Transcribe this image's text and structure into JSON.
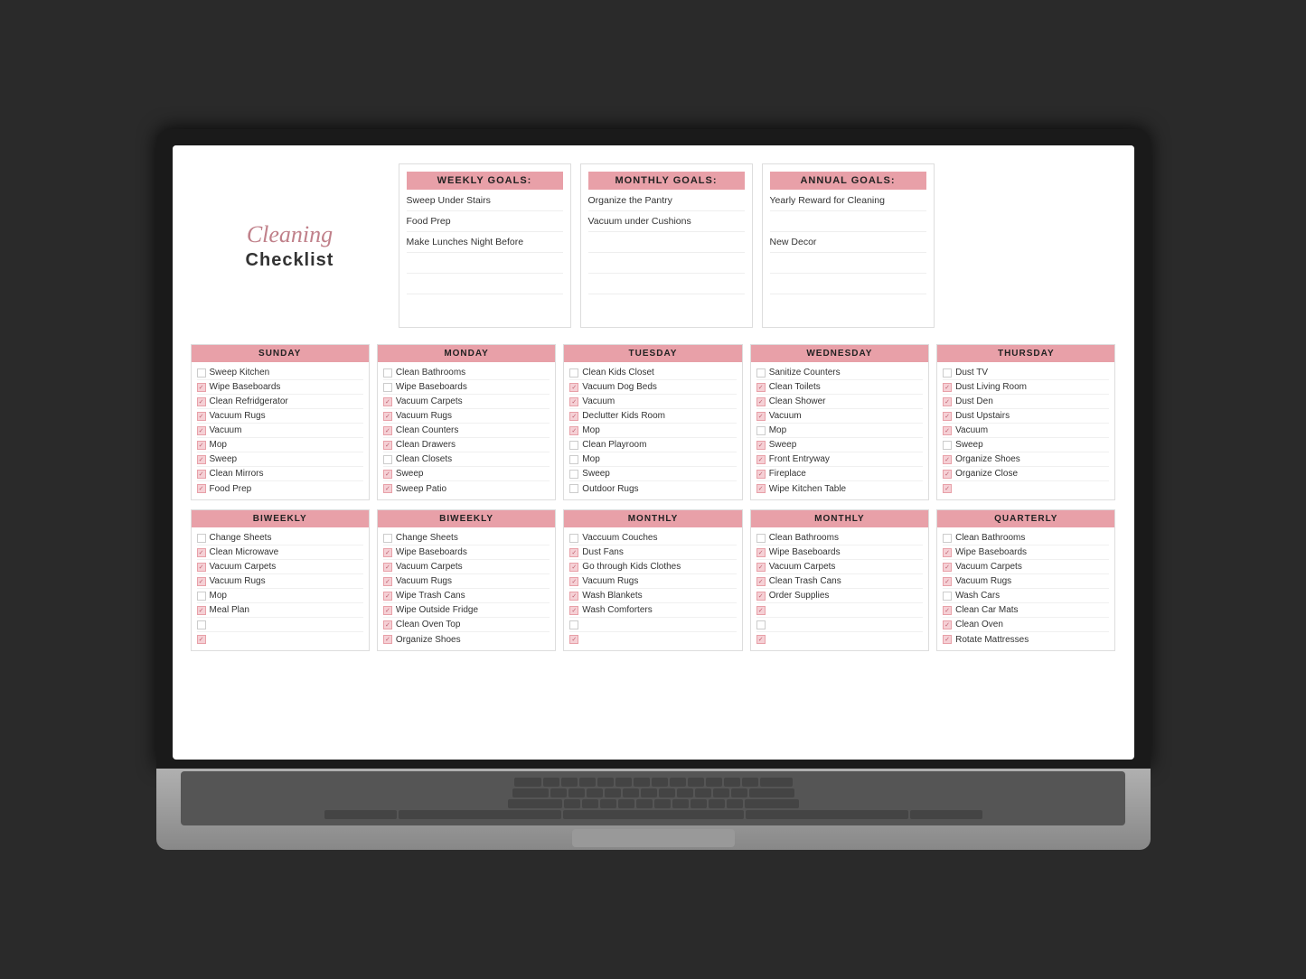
{
  "logo": {
    "cursive": "Cleaning",
    "print": "Checklist"
  },
  "goals": {
    "weekly": {
      "header": "WEEKLY GOALS:",
      "items": [
        "Sweep Under Stairs",
        "Food Prep",
        "Make Lunches Night Before",
        "",
        "",
        ""
      ]
    },
    "monthly": {
      "header": "MONTHLY GOALS:",
      "items": [
        "Organize the Pantry",
        "Vacuum under Cushions",
        "",
        "",
        "",
        ""
      ]
    },
    "annual": {
      "header": "ANNUAL GOALS:",
      "items": [
        "Yearly Reward for Cleaning",
        "",
        "New Decor",
        "",
        "",
        ""
      ]
    }
  },
  "daily": {
    "columns": [
      {
        "header": "SUNDAY",
        "items": [
          {
            "text": "Sweep Kitchen",
            "checked": false
          },
          {
            "text": "Wipe Baseboards",
            "checked": true
          },
          {
            "text": "Clean Refridgerator",
            "checked": true
          },
          {
            "text": "Vacuum Rugs",
            "checked": true
          },
          {
            "text": "Vacuum",
            "checked": true
          },
          {
            "text": "Mop",
            "checked": true
          },
          {
            "text": "Sweep",
            "checked": true
          },
          {
            "text": "Clean Mirrors",
            "checked": true
          },
          {
            "text": "Food Prep",
            "checked": true
          }
        ]
      },
      {
        "header": "MONDAY",
        "items": [
          {
            "text": "Clean Bathrooms",
            "checked": false
          },
          {
            "text": "Wipe Baseboards",
            "checked": false
          },
          {
            "text": "Vacuum Carpets",
            "checked": true
          },
          {
            "text": "Vacuum Rugs",
            "checked": true
          },
          {
            "text": "Clean Counters",
            "checked": true
          },
          {
            "text": "Clean Drawers",
            "checked": true
          },
          {
            "text": "Clean Closets",
            "checked": false
          },
          {
            "text": "Sweep",
            "checked": true
          },
          {
            "text": "Sweep Patio",
            "checked": true
          }
        ]
      },
      {
        "header": "TUESDAY",
        "items": [
          {
            "text": "Clean Kids Closet",
            "checked": false
          },
          {
            "text": "Vacuum Dog Beds",
            "checked": true
          },
          {
            "text": "Vacuum",
            "checked": true
          },
          {
            "text": "Declutter Kids Room",
            "checked": true
          },
          {
            "text": "Mop",
            "checked": true
          },
          {
            "text": "Clean Playroom",
            "checked": false
          },
          {
            "text": "Mop",
            "checked": false
          },
          {
            "text": "Sweep",
            "checked": false
          },
          {
            "text": "Outdoor Rugs",
            "checked": false
          }
        ]
      },
      {
        "header": "WEDNESDAY",
        "items": [
          {
            "text": "Sanitize Counters",
            "checked": false
          },
          {
            "text": "Clean Toilets",
            "checked": true
          },
          {
            "text": "Clean Shower",
            "checked": true
          },
          {
            "text": "Vacuum",
            "checked": true
          },
          {
            "text": "Mop",
            "checked": false
          },
          {
            "text": "Sweep",
            "checked": true
          },
          {
            "text": "Front Entryway",
            "checked": true
          },
          {
            "text": "Fireplace",
            "checked": true
          },
          {
            "text": "Wipe Kitchen Table",
            "checked": true
          }
        ]
      },
      {
        "header": "THURSDAY",
        "items": [
          {
            "text": "Dust TV",
            "checked": false
          },
          {
            "text": "Dust Living Room",
            "checked": true
          },
          {
            "text": "Dust Den",
            "checked": true
          },
          {
            "text": "Dust Upstairs",
            "checked": true
          },
          {
            "text": "Vacuum",
            "checked": true
          },
          {
            "text": "Sweep",
            "checked": false
          },
          {
            "text": "Organize Shoes",
            "checked": true
          },
          {
            "text": "Organize Close",
            "checked": true
          },
          {
            "text": "",
            "checked": true
          }
        ]
      }
    ]
  },
  "periodic": {
    "columns": [
      {
        "header": "BIWEEKLY",
        "items": [
          {
            "text": "Change Sheets",
            "checked": false
          },
          {
            "text": "Clean Microwave",
            "checked": true
          },
          {
            "text": "Vacuum Carpets",
            "checked": true
          },
          {
            "text": "Vacuum Rugs",
            "checked": true
          },
          {
            "text": "Mop",
            "checked": false
          },
          {
            "text": "Meal Plan",
            "checked": true
          },
          {
            "text": "",
            "checked": false
          },
          {
            "text": "",
            "checked": true
          }
        ]
      },
      {
        "header": "BIWEEKLY",
        "items": [
          {
            "text": "Change Sheets",
            "checked": false
          },
          {
            "text": "Wipe Baseboards",
            "checked": true
          },
          {
            "text": "Vacuum Carpets",
            "checked": true
          },
          {
            "text": "Vacuum Rugs",
            "checked": true
          },
          {
            "text": "Wipe Trash Cans",
            "checked": true
          },
          {
            "text": "Wipe Outside Fridge",
            "checked": true
          },
          {
            "text": "Clean Oven Top",
            "checked": true
          },
          {
            "text": "Organize Shoes",
            "checked": true
          }
        ]
      },
      {
        "header": "MONTHLY",
        "items": [
          {
            "text": "Vaccuum Couches",
            "checked": false
          },
          {
            "text": "Dust Fans",
            "checked": true
          },
          {
            "text": "Go through Kids Clothes",
            "checked": true
          },
          {
            "text": "Vacuum Rugs",
            "checked": true
          },
          {
            "text": "Wash Blankets",
            "checked": true
          },
          {
            "text": "Wash Comforters",
            "checked": true
          },
          {
            "text": "",
            "checked": false
          },
          {
            "text": "",
            "checked": true
          }
        ]
      },
      {
        "header": "MONTHLY",
        "items": [
          {
            "text": "Clean Bathrooms",
            "checked": false
          },
          {
            "text": "Wipe Baseboards",
            "checked": true
          },
          {
            "text": "Vacuum Carpets",
            "checked": true
          },
          {
            "text": "Clean Trash Cans",
            "checked": true
          },
          {
            "text": "Order Supplies",
            "checked": true
          },
          {
            "text": "",
            "checked": true
          },
          {
            "text": "",
            "checked": false
          },
          {
            "text": "",
            "checked": true
          }
        ]
      },
      {
        "header": "QUARTERLY",
        "items": [
          {
            "text": "Clean Bathrooms",
            "checked": false
          },
          {
            "text": "Wipe Baseboards",
            "checked": true
          },
          {
            "text": "Vacuum Carpets",
            "checked": true
          },
          {
            "text": "Vacuum Rugs",
            "checked": true
          },
          {
            "text": "Wash Cars",
            "checked": false
          },
          {
            "text": "Clean Car Mats",
            "checked": true
          },
          {
            "text": "Clean Oven",
            "checked": true
          },
          {
            "text": "Rotate Mattresses",
            "checked": true
          }
        ]
      }
    ]
  }
}
